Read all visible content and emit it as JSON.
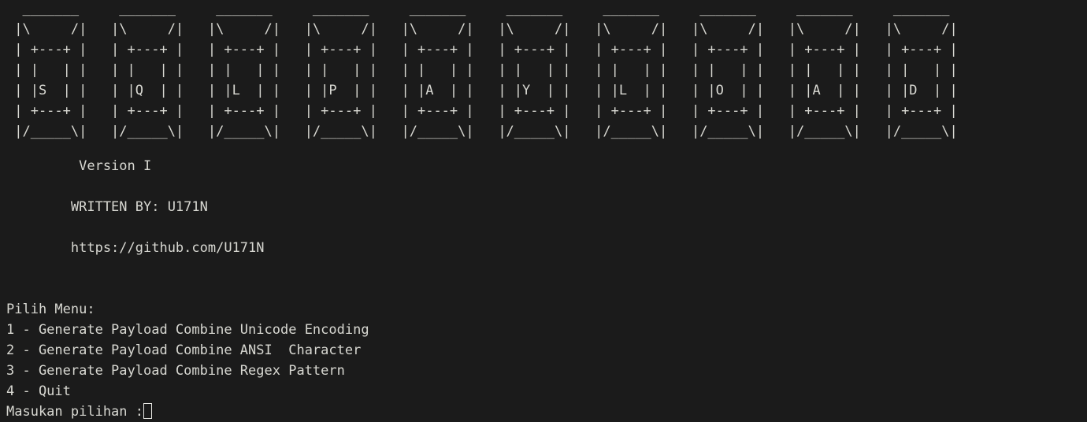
{
  "terminal": {
    "background_color": "#1b1b1b",
    "foreground_color": "#d8d8d2",
    "cursor_color": "#e8e8e4",
    "cursor_style": "hollow-block"
  },
  "banner": {
    "letters": [
      "S",
      "Q",
      "L",
      "P",
      "A",
      "Y",
      "L",
      "O",
      "A",
      "D"
    ],
    "word": "SQLPAYLOAD",
    "box_rows": [
      " _______ ",
      "|\\     /|",
      "| +---+ |",
      "| |   | |",
      "| |X  | |",
      "| +---+ |",
      "|/_____\\|"
    ],
    "letter_row_index": 4,
    "box_gap_spaces": 3,
    "ascii_art": "  _______     _______     _______     _______     _______     _______     _______     _______     _______     _______  \n |\\     /|   |\\     /|   |\\     /|   |\\     /|   |\\     /|   |\\     /|   |\\     /|   |\\     /|   |\\     /|   |\\     /| \n | +---+ |   | +---+ |   | +---+ |   | +---+ |   | +---+ |   | +---+ |   | +---+ |   | +---+ |   | +---+ |   | +---+ | \n | |   | |   | |   | |   | |   | |   | |   | |   | |   | |   | |   | |   | |   | |   | |   | |   | |   | |   | |   | | \n | |S  | |   | |Q  | |   | |L  | |   | |P  | |   | |A  | |   | |Y  | |   | |L  | |   | |O  | |   | |A  | |   | |D  | | \n | +---+ |   | +---+ |   | +---+ |   | +---+ |   | +---+ |   | +---+ |   | +---+ |   | +---+ |   | +---+ |   | +---+ | \n |/_____\\|   |/_____\\|   |/_____\\|   |/_____\\|   |/_____\\|   |/_____\\|   |/_____\\|   |/_____\\|   |/_____\\|   |/_____\\| "
  },
  "credits": {
    "version": "         Version I",
    "version_text": "Version I",
    "author": "        WRITTEN BY: U171N",
    "author_text": "WRITTEN BY: U171N",
    "url": "        https://github.com/U171N",
    "url_text": "https://github.com/U171N"
  },
  "menu": {
    "heading": "Pilih Menu:",
    "options": [
      "1 - Generate Payload Combine Unicode Encoding",
      "2 - Generate Payload Combine ANSI  Character",
      "3 - Generate Payload Combine Regex Pattern",
      "4 - Quit"
    ],
    "prompt": "Masukan pilihan :",
    "input_value": ""
  }
}
